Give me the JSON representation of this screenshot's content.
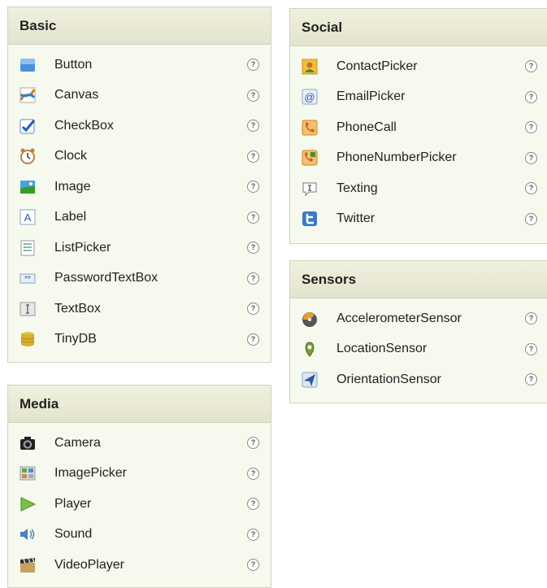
{
  "help_glyph": "?",
  "basic": {
    "title": "Basic",
    "items": [
      {
        "label": "Button",
        "icon": "button-icon"
      },
      {
        "label": "Canvas",
        "icon": "canvas-icon"
      },
      {
        "label": "CheckBox",
        "icon": "checkbox-icon"
      },
      {
        "label": "Clock",
        "icon": "clock-icon"
      },
      {
        "label": "Image",
        "icon": "image-icon"
      },
      {
        "label": "Label",
        "icon": "label-icon"
      },
      {
        "label": "ListPicker",
        "icon": "listpicker-icon"
      },
      {
        "label": "PasswordTextBox",
        "icon": "password-icon"
      },
      {
        "label": "TextBox",
        "icon": "textbox-icon"
      },
      {
        "label": "TinyDB",
        "icon": "database-icon"
      }
    ]
  },
  "media": {
    "title": "Media",
    "items": [
      {
        "label": "Camera",
        "icon": "camera-icon"
      },
      {
        "label": "ImagePicker",
        "icon": "imagepicker-icon"
      },
      {
        "label": "Player",
        "icon": "player-icon"
      },
      {
        "label": "Sound",
        "icon": "sound-icon"
      },
      {
        "label": "VideoPlayer",
        "icon": "video-icon"
      }
    ]
  },
  "social": {
    "title": "Social",
    "items": [
      {
        "label": "ContactPicker",
        "icon": "contact-icon"
      },
      {
        "label": "EmailPicker",
        "icon": "email-icon"
      },
      {
        "label": "PhoneCall",
        "icon": "phone-icon"
      },
      {
        "label": "PhoneNumberPicker",
        "icon": "phonenumber-icon"
      },
      {
        "label": "Texting",
        "icon": "texting-icon"
      },
      {
        "label": "Twitter",
        "icon": "twitter-icon"
      }
    ]
  },
  "sensors": {
    "title": "Sensors",
    "items": [
      {
        "label": "AccelerometerSensor",
        "icon": "accelerometer-icon"
      },
      {
        "label": "LocationSensor",
        "icon": "location-icon"
      },
      {
        "label": "OrientationSensor",
        "icon": "orientation-icon"
      }
    ]
  }
}
